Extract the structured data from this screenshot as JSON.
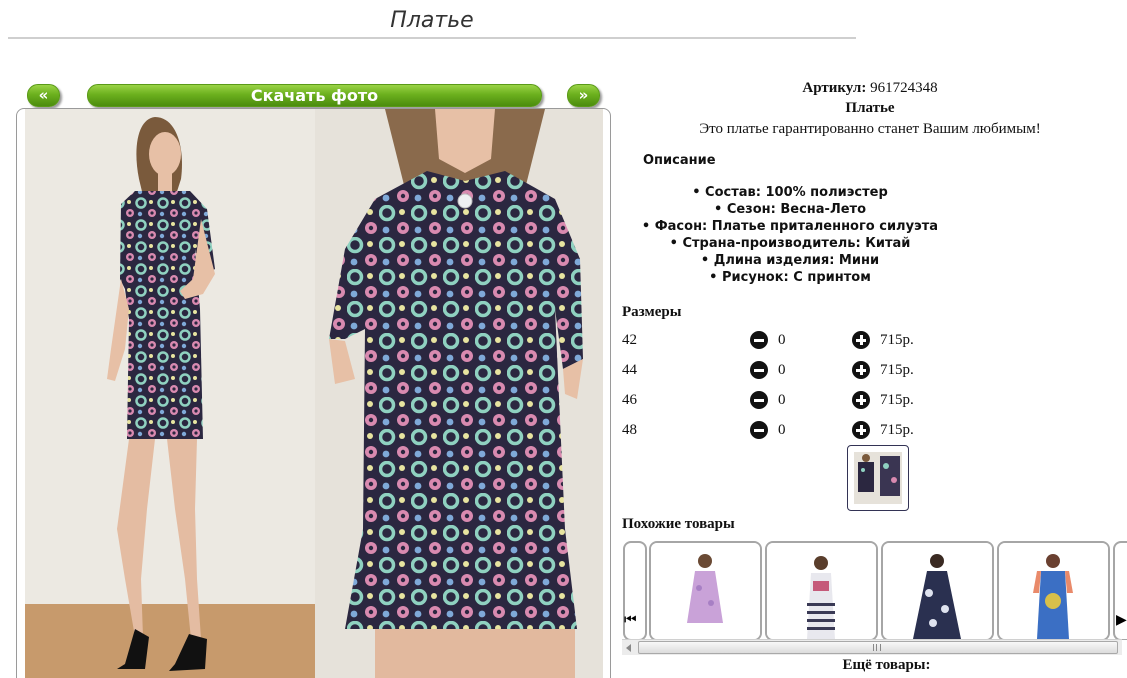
{
  "page": {
    "title": "Платье"
  },
  "gallery": {
    "prev_label": "«",
    "download_label": "Скачать фото",
    "next_label": "»"
  },
  "product": {
    "article_label": "Артикул:",
    "article_value": "961724348",
    "name": "Платье",
    "tagline": "Это платье гарантированно станет Вашим любимым!",
    "description_heading": "Описание",
    "description_items": [
      "Состав: 100% полиэстер",
      "Сезон: Весна-Лето",
      "Фасон: Платье приталенного силуэта",
      "Страна-производитель: Китай",
      "Длина изделия: Мини",
      "Рисунок: С принтом"
    ]
  },
  "sizes": {
    "heading": "Размеры",
    "rows": [
      {
        "size": "42",
        "qty": "0",
        "price": "715р."
      },
      {
        "size": "44",
        "qty": "0",
        "price": "715р."
      },
      {
        "size": "46",
        "qty": "0",
        "price": "715р."
      },
      {
        "size": "48",
        "qty": "0",
        "price": "715р."
      }
    ]
  },
  "similar": {
    "heading": "Похожие товары",
    "more_heading": "Ещё товары:"
  },
  "colors": {
    "accent_green": "#6cb01e",
    "dress_dark": "#2b2740",
    "wall": "#ece9e2"
  }
}
